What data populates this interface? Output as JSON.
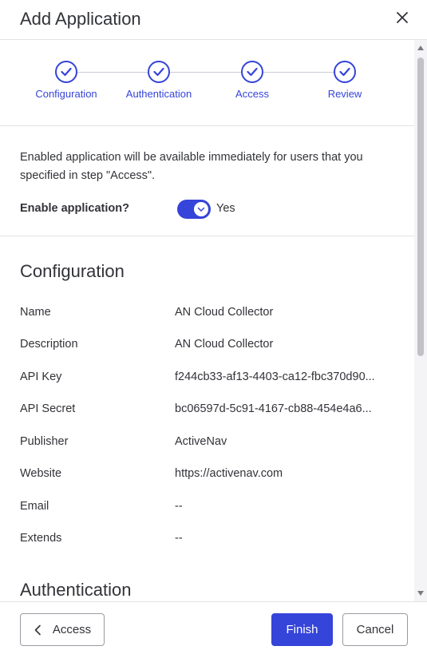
{
  "dialog": {
    "title": "Add Application",
    "close_icon": "close-icon"
  },
  "stepper": {
    "steps": [
      {
        "label": "Configuration",
        "status": "completed",
        "icon": "check-icon"
      },
      {
        "label": "Authentication",
        "status": "completed",
        "icon": "check-icon"
      },
      {
        "label": "Access",
        "status": "completed",
        "icon": "check-icon"
      },
      {
        "label": "Review",
        "status": "completed",
        "icon": "check-icon"
      }
    ]
  },
  "enable": {
    "description": "Enabled application will be available immediately for users that you specified in step \"Access\".",
    "label": "Enable application?",
    "toggle_on": true,
    "toggle_text": "Yes"
  },
  "configuration": {
    "title": "Configuration",
    "rows": [
      {
        "key": "Name",
        "value": "AN Cloud Collector"
      },
      {
        "key": "Description",
        "value": "AN Cloud Collector"
      },
      {
        "key": "API Key",
        "value": "f244cb33-af13-4403-ca12-fbc370d90..."
      },
      {
        "key": "API Secret",
        "value": "bc06597d-5c91-4167-cb88-454e4a6..."
      },
      {
        "key": "Publisher",
        "value": "ActiveNav"
      },
      {
        "key": "Website",
        "value": "https://activenav.com"
      },
      {
        "key": "Email",
        "value": "--"
      },
      {
        "key": "Extends",
        "value": "--"
      }
    ]
  },
  "authentication": {
    "title": "Authentication"
  },
  "footer": {
    "back_label": "Access",
    "finish_label": "Finish",
    "cancel_label": "Cancel"
  },
  "colors": {
    "accent": "#3544d9",
    "text": "#323338",
    "border": "#e3e3e6"
  }
}
